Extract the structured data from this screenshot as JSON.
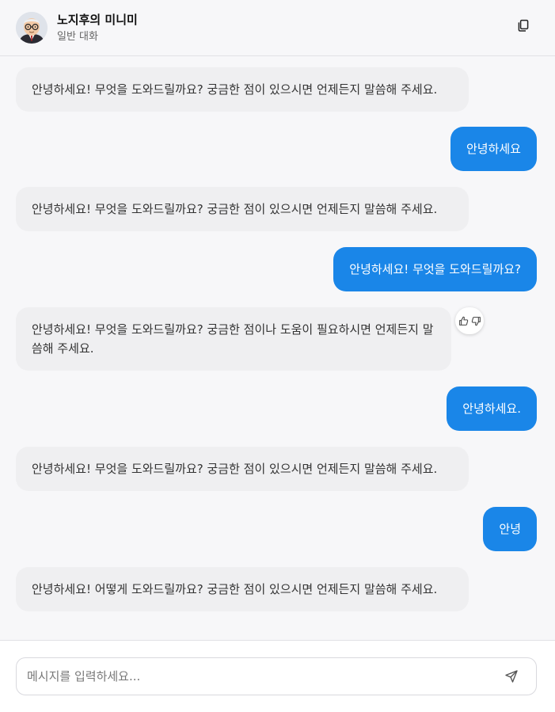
{
  "header": {
    "title": "노지후의 미니미",
    "subtitle": "일반 대화",
    "avatar_icon": "avatar-glasses-man",
    "copy_icon": "copy-icon"
  },
  "messages": [
    {
      "role": "bot",
      "text": "안녕하세요! 무엇을 도와드릴까요? 궁금한 점이 있으시면 언제든지 말씀해 주세요."
    },
    {
      "role": "user",
      "text": "안녕하세요"
    },
    {
      "role": "bot",
      "text": "안녕하세요! 무엇을 도와드릴까요? 궁금한 점이 있으시면 언제든지 말씀해 주세요."
    },
    {
      "role": "user",
      "text": "안녕하세요! 무엇을 도와드릴까요?"
    },
    {
      "role": "bot",
      "text": "안녕하세요! 무엇을 도와드릴까요? 궁금한 점이나 도움이 필요하시면 언제든지 말씀해 주세요."
    },
    {
      "role": "user",
      "text": "안녕하세요."
    },
    {
      "role": "bot",
      "text": "안녕하세요! 무엇을 도와드릴까요? 궁금한 점이 있으시면 언제든지 말씀해 주세요."
    },
    {
      "role": "user",
      "text": "안녕"
    },
    {
      "role": "bot",
      "text": "안녕하세요! 어떻게 도와드릴까요? 궁금한 점이 있으시면 언제든지 말씀해 주세요."
    }
  ],
  "feedback": {
    "like_icon": "thumbs-up-icon",
    "dislike_icon": "thumbs-down-icon"
  },
  "composer": {
    "placeholder": "메시지를 입력하세요...",
    "value": "",
    "send_icon": "send-icon"
  },
  "colors": {
    "user_bubble": "#1a86e8",
    "bot_bubble": "#efeff1",
    "background": "#f7f7f9"
  }
}
